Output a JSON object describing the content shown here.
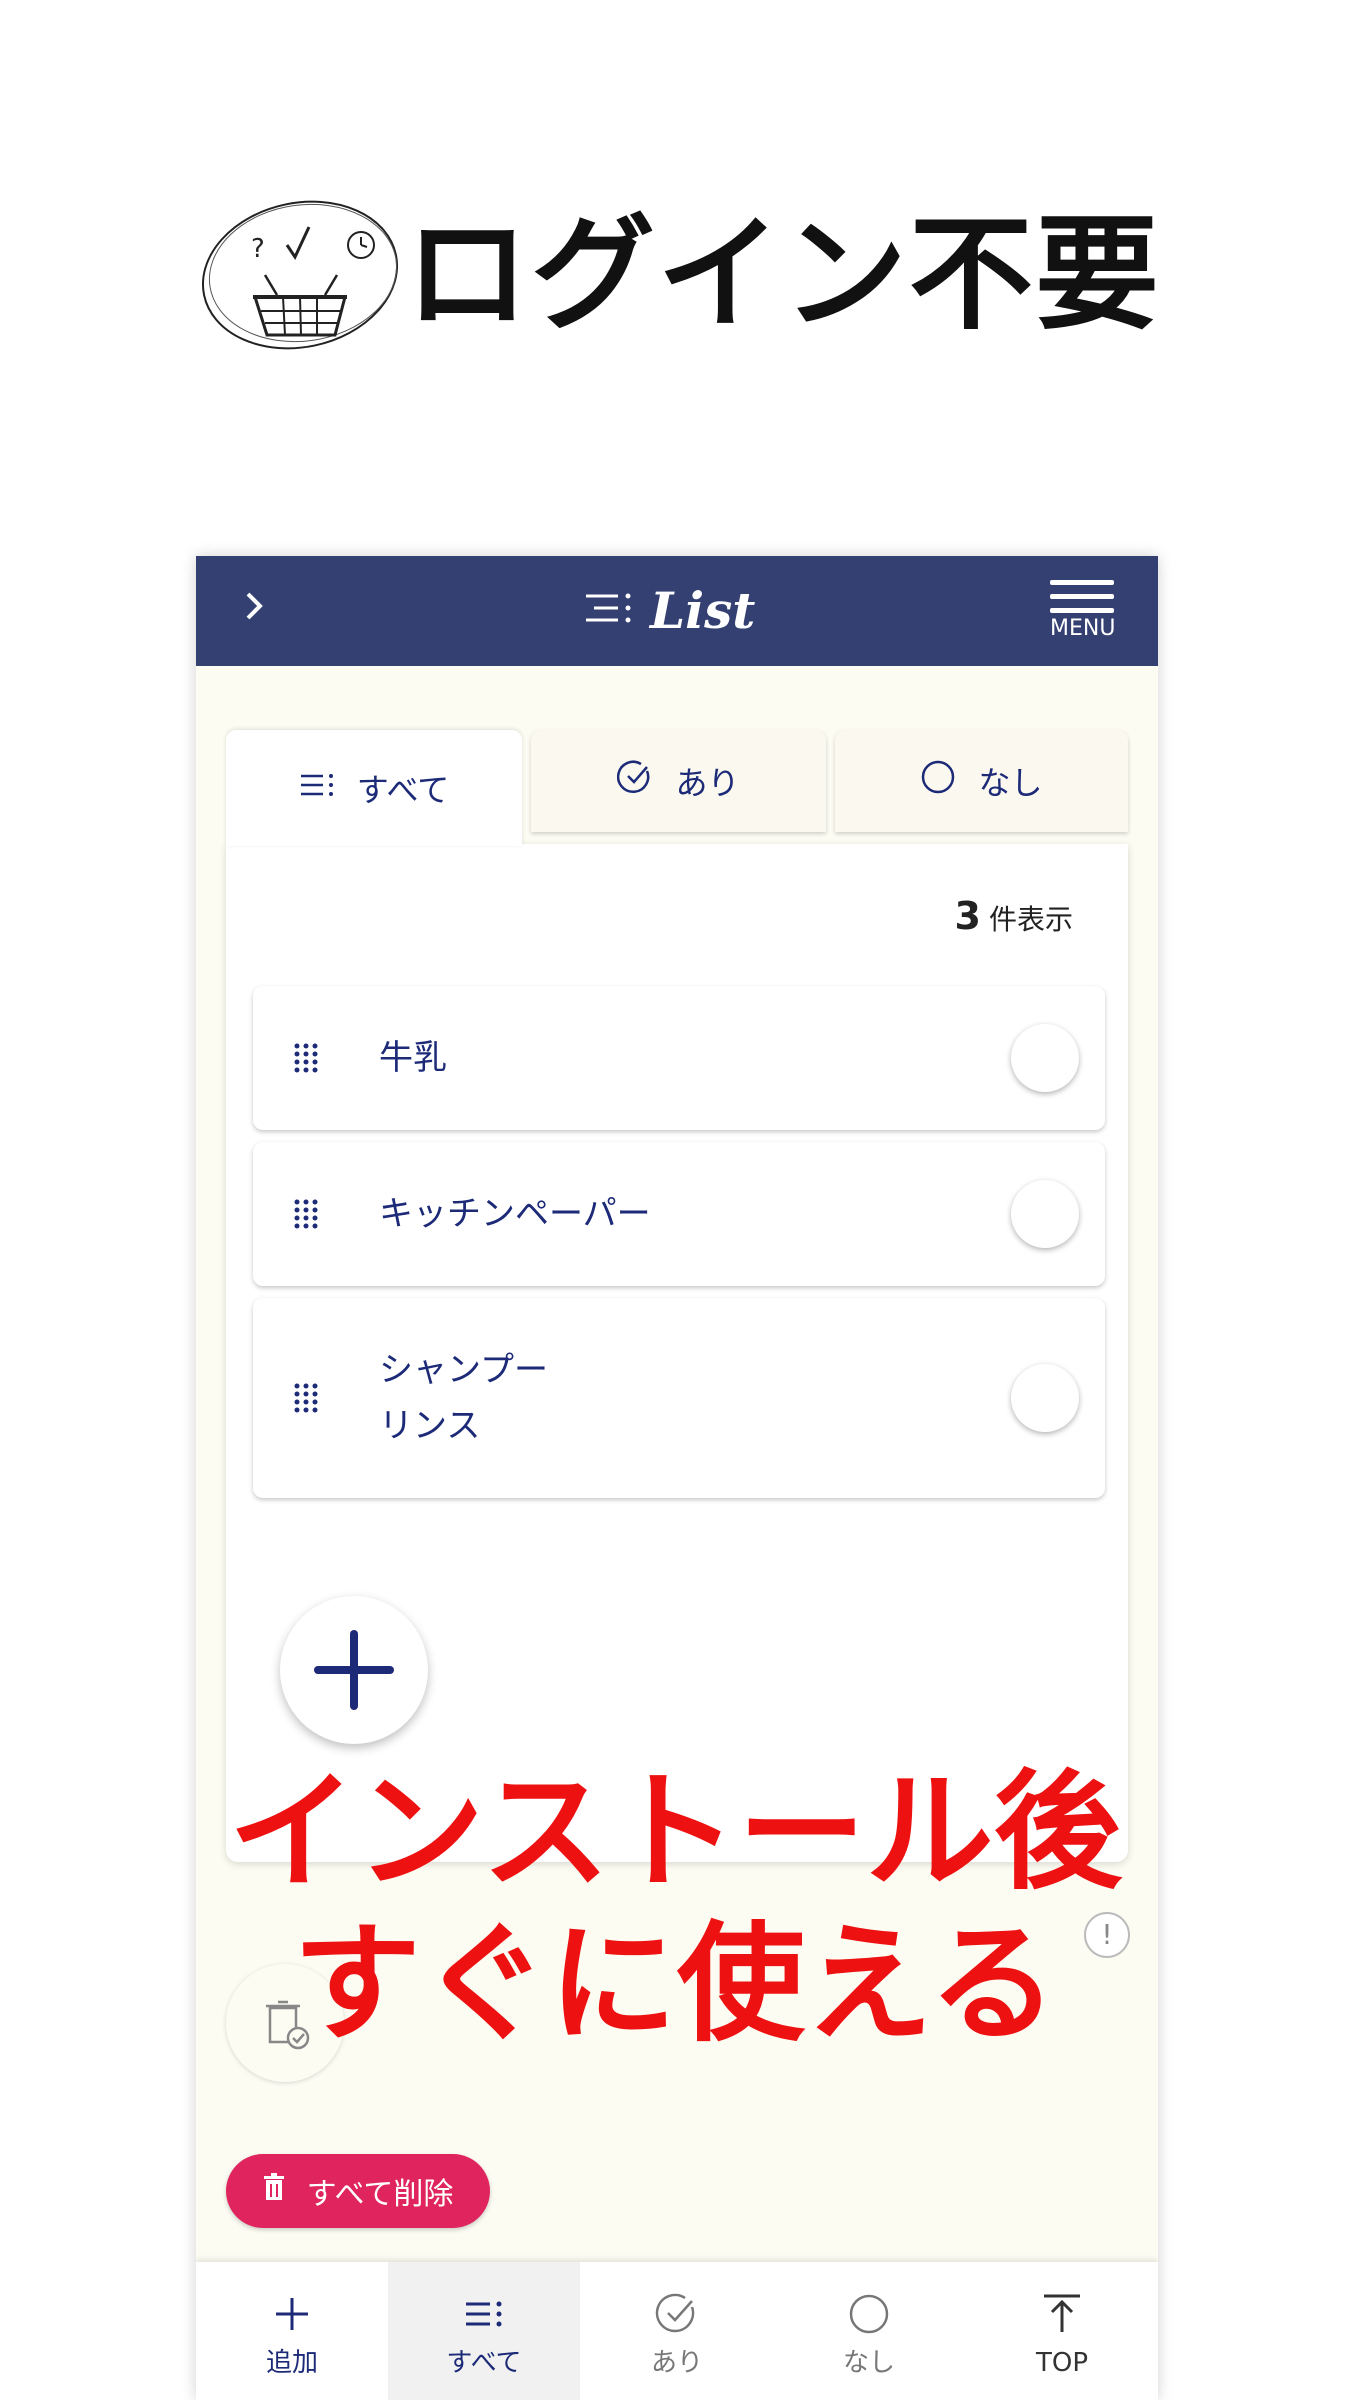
{
  "promo": {
    "headline": "ログイン不要",
    "overlay_line1": "インストール後",
    "overlay_line2": "すぐに使える"
  },
  "appbar": {
    "back_icon": "chevron-right-icon",
    "title": "List",
    "menu_label": "MENU"
  },
  "tabs": [
    {
      "label": "すべて",
      "icon": "list-icon",
      "active": true
    },
    {
      "label": "あり",
      "icon": "check-circle-icon",
      "active": false
    },
    {
      "label": "なし",
      "icon": "circle-icon",
      "active": false
    }
  ],
  "list": {
    "count": "3",
    "count_suffix": "件表示",
    "items": [
      {
        "line1": "牛乳",
        "line2": ""
      },
      {
        "line1": "キッチンペーパー",
        "line2": ""
      },
      {
        "line1": "シャンプー",
        "line2": "リンス"
      }
    ]
  },
  "info_badge": "!",
  "delete_all_label": "すべて削除",
  "bottom_nav": [
    {
      "label": "追加",
      "icon": "plus-icon"
    },
    {
      "label": "すべて",
      "icon": "list-icon",
      "active": true
    },
    {
      "label": "あり",
      "icon": "check-circle-icon"
    },
    {
      "label": "なし",
      "icon": "circle-icon"
    },
    {
      "label": "TOP",
      "icon": "arrow-up-icon"
    }
  ],
  "colors": {
    "appbar": "#344072",
    "accent_text": "#1c2a78",
    "delete_button": "#e0245e",
    "overlay_text": "#ee1111",
    "background": "#fcfcf3"
  }
}
